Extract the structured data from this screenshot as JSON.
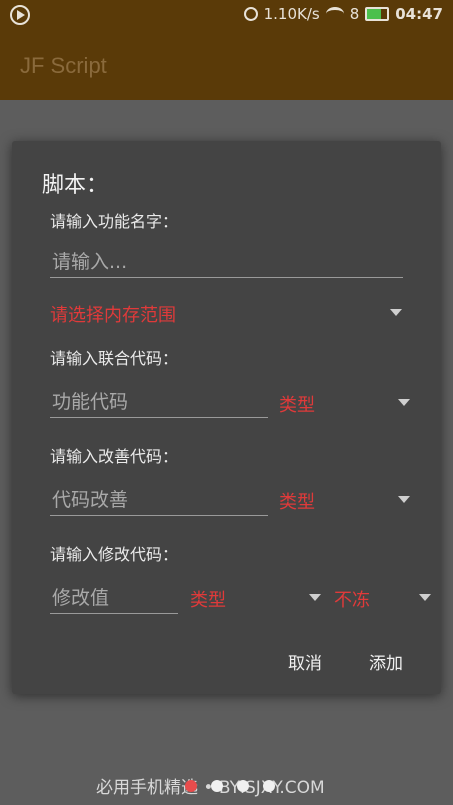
{
  "status_bar": {
    "network_speed": "1.10K/s",
    "battery_text": "8",
    "time": "04:47"
  },
  "app_bar": {
    "title": "JF Script"
  },
  "dialog": {
    "title": "脚本：",
    "function_name": {
      "label": "请输入功能名字：",
      "placeholder": "请输入...",
      "value": ""
    },
    "memory_range": {
      "selected": "请选择内存范围"
    },
    "joint_code": {
      "label": "请输入联合代码：",
      "placeholder": "功能代码",
      "type_selected": "类型"
    },
    "improve_code": {
      "label": "请输入改善代码：",
      "placeholder": "代码改善",
      "type_selected": "类型"
    },
    "modify_code": {
      "label": "请输入修改代码：",
      "placeholder": "修改值",
      "type_selected": "类型",
      "freeze_selected": "不冻"
    },
    "cancel_label": "取消",
    "add_label": "添加"
  },
  "watermark": "必用手机精选 • BYISJXY.COM",
  "page_indicator": {
    "count": 4,
    "active_index": 0
  },
  "colors": {
    "app_bar": "#5a3a08",
    "dialog_bg": "#444444",
    "select_text": "#e03a3a",
    "accent_dot": "#e84c4c"
  }
}
